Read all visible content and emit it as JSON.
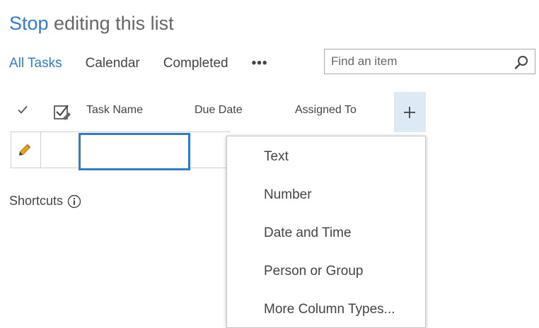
{
  "header": {
    "title_link": "Stop",
    "title_rest": " editing this list"
  },
  "views": {
    "items": [
      "All Tasks",
      "Calendar",
      "Completed"
    ],
    "more": "•••",
    "active": "All Tasks"
  },
  "search": {
    "placeholder": "Find an item"
  },
  "columns": {
    "task_name": "Task Name",
    "due_date": "Due Date",
    "assigned_to": "Assigned To",
    "add_column": "+"
  },
  "shortcuts": {
    "label": "Shortcuts"
  },
  "column_menu": {
    "items": [
      "Text",
      "Number",
      "Date and Time",
      "Person or Group",
      "More Column Types..."
    ]
  },
  "colors": {
    "accent": "#2e7bcf",
    "text": "#444444",
    "add_column_bg": "#dde9f5"
  }
}
